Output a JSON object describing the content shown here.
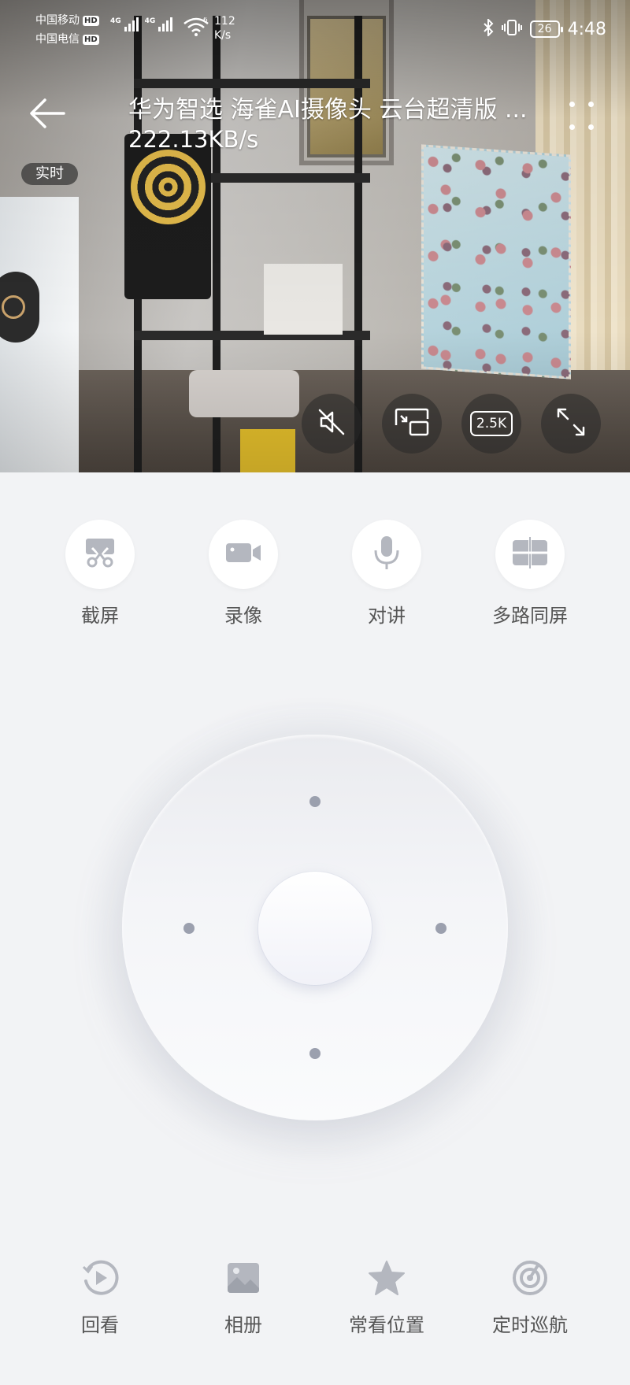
{
  "status_bar": {
    "carrier1": "中国移动",
    "carrier2": "中国电信",
    "hd": "HD",
    "net1": "4G",
    "net2": "4G",
    "wifi_tag": "6",
    "speed_value": "112",
    "speed_unit": "K/s",
    "battery": "26",
    "time": "4:48"
  },
  "header": {
    "title": "华为智选 海雀AI摄像头 云台超清版 ...",
    "bitrate": "222.13KB/s",
    "live_badge": "实时"
  },
  "overlay_controls": {
    "mute_icon": "speaker-muted-icon",
    "pip_icon": "picture-in-picture-icon",
    "resolution": "2.5K",
    "fullscreen_icon": "fullscreen-icon"
  },
  "actions": [
    {
      "label": "截屏",
      "icon": "scissors-icon"
    },
    {
      "label": "录像",
      "icon": "video-camera-icon"
    },
    {
      "label": "对讲",
      "icon": "microphone-icon"
    },
    {
      "label": "多路同屏",
      "icon": "split-screen-icon"
    }
  ],
  "bottom_nav": [
    {
      "label": "回看",
      "icon": "playback-icon"
    },
    {
      "label": "相册",
      "icon": "gallery-icon"
    },
    {
      "label": "常看位置",
      "icon": "star-icon"
    },
    {
      "label": "定时巡航",
      "icon": "cruise-icon"
    }
  ],
  "colors": {
    "background": "#f2f3f5",
    "icon_gray": "#b4b7bf",
    "dot_gray": "#9ba0ae"
  }
}
